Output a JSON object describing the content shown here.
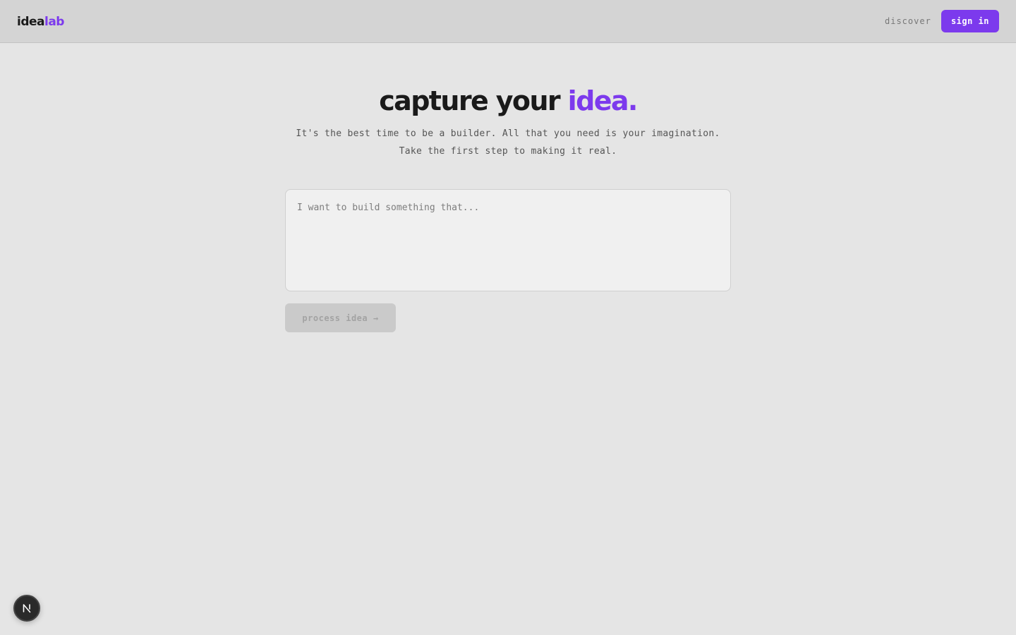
{
  "header": {
    "logo_part1": "idea",
    "logo_part2": "lab",
    "discover_label": "discover",
    "signin_label": "sign in"
  },
  "hero": {
    "title_part1": "capture your ",
    "title_accent": "idea.",
    "subtitle_line1": "It's the best time to be a builder. All that you need is your imagination.",
    "subtitle_line2": "Take the first step to making it real."
  },
  "form": {
    "idea_value": "",
    "idea_placeholder": "I want to build something that...",
    "process_label": "process idea →"
  },
  "badge": {
    "icon": "nextjs-n-icon"
  },
  "colors": {
    "accent": "#7c3aed",
    "background": "#e5e5e5",
    "topbar": "#d4d4d4",
    "button_disabled": "#cacaca"
  }
}
